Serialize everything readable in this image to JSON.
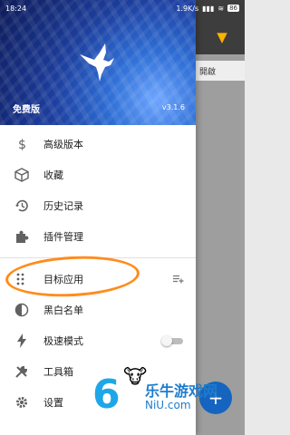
{
  "status_bar": {
    "time": "18:24",
    "net_speed": "1.9K/s",
    "battery": "86"
  },
  "background": {
    "chip_label": "開啟"
  },
  "drawer": {
    "edition": "免费版",
    "version": "v3.1.6",
    "items": [
      {
        "label": "高级版本",
        "icon": "dollar-icon"
      },
      {
        "label": "收藏",
        "icon": "box-icon"
      },
      {
        "label": "历史记录",
        "icon": "history-icon"
      },
      {
        "label": "插件管理",
        "icon": "puzzle-icon"
      },
      {
        "label": "目标应用",
        "icon": "apps-grid-icon"
      },
      {
        "label": "黑白名单",
        "icon": "contrast-icon"
      },
      {
        "label": "极速模式",
        "icon": "flash-icon"
      },
      {
        "label": "工具箱",
        "icon": "tools-icon"
      },
      {
        "label": "设置",
        "icon": "gear-icon"
      }
    ],
    "speed_mode_enabled": false
  },
  "watermark": {
    "number": "6",
    "brand": "乐牛游戏网",
    "sub": "NiU.com"
  },
  "colors": {
    "accent": "#ff8c1a",
    "header": "#1d3fa0",
    "icon": "#616161"
  }
}
